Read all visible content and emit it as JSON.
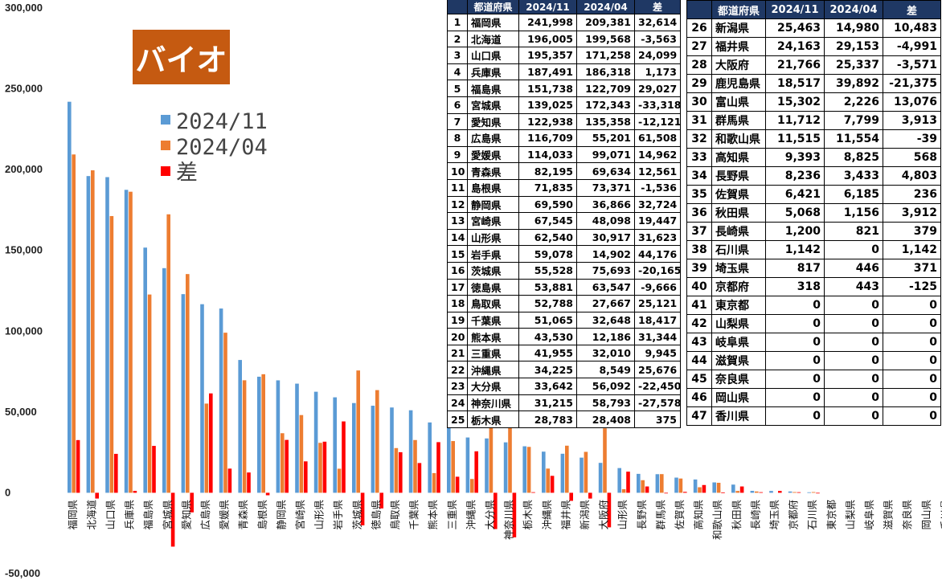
{
  "chart_data": {
    "type": "bar",
    "title": "バイオ",
    "categories": [
      "福岡県",
      "北海道",
      "山口県",
      "兵庫県",
      "福島県",
      "宮城県",
      "愛知県",
      "広島県",
      "愛媛県",
      "青森県",
      "島根県",
      "静岡県",
      "宮崎県",
      "山形県",
      "岩手県",
      "茨城県",
      "徳島県",
      "鳥取県",
      "千葉県",
      "熊本県",
      "三重県",
      "沖縄県",
      "大分県",
      "神奈川県",
      "栃木県",
      "沖縄県",
      "福井県",
      "新潟県",
      "大阪府",
      "山形県",
      "長野県",
      "群馬県",
      "佐賀県",
      "高知県",
      "和歌山県",
      "秋田県",
      "長崎県",
      "埼玉県",
      "京都府",
      "石川県",
      "東京都",
      "山梨県",
      "岐阜県",
      "滋賀県",
      "奈良県",
      "岡山県",
      "香川県"
    ],
    "series": [
      {
        "name": "2024/11",
        "color": "#5b9bd5",
        "values": [
          241998,
          196005,
          195357,
          187491,
          151738,
          139025,
          122938,
          116709,
          114033,
          82195,
          71835,
          69590,
          67545,
          62540,
          59078,
          55528,
          53881,
          52788,
          51065,
          43530,
          41955,
          34225,
          33642,
          31215,
          28783,
          25463,
          24163,
          21766,
          18517,
          15302,
          11712,
          11515,
          9393,
          8236,
          6421,
          5068,
          1200,
          1142,
          817,
          318,
          0,
          0,
          0,
          0,
          0,
          0,
          0
        ]
      },
      {
        "name": "2024/04",
        "color": "#ed7d31",
        "values": [
          209381,
          199568,
          171258,
          186318,
          122709,
          172343,
          135358,
          55201,
          99071,
          69634,
          73371,
          36866,
          48098,
          30917,
          14902,
          75693,
          63547,
          27667,
          32648,
          12186,
          32010,
          8549,
          56092,
          58793,
          28408,
          14980,
          29153,
          25337,
          39892,
          2226,
          7799,
          11554,
          8825,
          3433,
          6185,
          1156,
          821,
          0,
          446,
          443,
          0,
          0,
          0,
          0,
          0,
          0,
          0
        ]
      },
      {
        "name": "差",
        "color": "#ff0000",
        "values": [
          32614,
          -3563,
          24099,
          1173,
          29027,
          -33318,
          -12121,
          61508,
          14962,
          12561,
          -1536,
          32724,
          19447,
          31623,
          44176,
          -20165,
          -9666,
          25121,
          18417,
          31344,
          9945,
          25676,
          -22450,
          -27578,
          375,
          10483,
          -4991,
          -3571,
          -21375,
          13076,
          3913,
          -39,
          568,
          4803,
          236,
          3912,
          379,
          1142,
          371,
          -125,
          0,
          0,
          0,
          0,
          0,
          0,
          0
        ]
      }
    ],
    "ylim": [
      -50000,
      300000
    ],
    "yticks": [
      "-50,000",
      "0",
      "50,000",
      "100,000",
      "150,000",
      "200,000",
      "250,000",
      "300,000"
    ],
    "xlabel": "",
    "ylabel": "",
    "legend_position": "top-left"
  },
  "table_left": {
    "headers": [
      "",
      "都道府県",
      "2024/11",
      "2024/04",
      "差"
    ],
    "rows": [
      [
        "1",
        "福岡県",
        "241,998",
        "209,381",
        "32,614"
      ],
      [
        "2",
        "北海道",
        "196,005",
        "199,568",
        "-3,563"
      ],
      [
        "3",
        "山口県",
        "195,357",
        "171,258",
        "24,099"
      ],
      [
        "4",
        "兵庫県",
        "187,491",
        "186,318",
        "1,173"
      ],
      [
        "5",
        "福島県",
        "151,738",
        "122,709",
        "29,027"
      ],
      [
        "6",
        "宮城県",
        "139,025",
        "172,343",
        "-33,318"
      ],
      [
        "7",
        "愛知県",
        "122,938",
        "135,358",
        "-12,121"
      ],
      [
        "8",
        "広島県",
        "116,709",
        "55,201",
        "61,508"
      ],
      [
        "9",
        "愛媛県",
        "114,033",
        "99,071",
        "14,962"
      ],
      [
        "10",
        "青森県",
        "82,195",
        "69,634",
        "12,561"
      ],
      [
        "11",
        "島根県",
        "71,835",
        "73,371",
        "-1,536"
      ],
      [
        "12",
        "静岡県",
        "69,590",
        "36,866",
        "32,724"
      ],
      [
        "13",
        "宮崎県",
        "67,545",
        "48,098",
        "19,447"
      ],
      [
        "14",
        "山形県",
        "62,540",
        "30,917",
        "31,623"
      ],
      [
        "15",
        "岩手県",
        "59,078",
        "14,902",
        "44,176"
      ],
      [
        "16",
        "茨城県",
        "55,528",
        "75,693",
        "-20,165"
      ],
      [
        "17",
        "徳島県",
        "53,881",
        "63,547",
        "-9,666"
      ],
      [
        "18",
        "鳥取県",
        "52,788",
        "27,667",
        "25,121"
      ],
      [
        "19",
        "千葉県",
        "51,065",
        "32,648",
        "18,417"
      ],
      [
        "20",
        "熊本県",
        "43,530",
        "12,186",
        "31,344"
      ],
      [
        "21",
        "三重県",
        "41,955",
        "32,010",
        "9,945"
      ],
      [
        "22",
        "沖縄県",
        "34,225",
        "8,549",
        "25,676"
      ],
      [
        "23",
        "大分県",
        "33,642",
        "56,092",
        "-22,450"
      ],
      [
        "24",
        "神奈川県",
        "31,215",
        "58,793",
        "-27,578"
      ],
      [
        "25",
        "栃木県",
        "28,783",
        "28,408",
        "375"
      ]
    ]
  },
  "table_right": {
    "headers": [
      "",
      "都道府県",
      "2024/11",
      "2024/04",
      "差"
    ],
    "rows": [
      [
        "26",
        "新潟県",
        "25,463",
        "14,980",
        "10,483"
      ],
      [
        "27",
        "福井県",
        "24,163",
        "29,153",
        "-4,991"
      ],
      [
        "28",
        "大阪府",
        "21,766",
        "25,337",
        "-3,571"
      ],
      [
        "29",
        "鹿児島県",
        "18,517",
        "39,892",
        "-21,375"
      ],
      [
        "30",
        "富山県",
        "15,302",
        "2,226",
        "13,076"
      ],
      [
        "31",
        "群馬県",
        "11,712",
        "7,799",
        "3,913"
      ],
      [
        "32",
        "和歌山県",
        "11,515",
        "11,554",
        "-39"
      ],
      [
        "33",
        "高知県",
        "9,393",
        "8,825",
        "568"
      ],
      [
        "34",
        "長野県",
        "8,236",
        "3,433",
        "4,803"
      ],
      [
        "35",
        "佐賀県",
        "6,421",
        "6,185",
        "236"
      ],
      [
        "36",
        "秋田県",
        "5,068",
        "1,156",
        "3,912"
      ],
      [
        "37",
        "長崎県",
        "1,200",
        "821",
        "379"
      ],
      [
        "38",
        "石川県",
        "1,142",
        "0",
        "1,142"
      ],
      [
        "39",
        "埼玉県",
        "817",
        "446",
        "371"
      ],
      [
        "40",
        "京都府",
        "318",
        "443",
        "-125"
      ],
      [
        "41",
        "東京都",
        "0",
        "0",
        "0"
      ],
      [
        "42",
        "山梨県",
        "0",
        "0",
        "0"
      ],
      [
        "43",
        "岐阜県",
        "0",
        "0",
        "0"
      ],
      [
        "44",
        "滋賀県",
        "0",
        "0",
        "0"
      ],
      [
        "45",
        "奈良県",
        "0",
        "0",
        "0"
      ],
      [
        "46",
        "岡山県",
        "0",
        "0",
        "0"
      ],
      [
        "47",
        "香川県",
        "0",
        "0",
        "0"
      ]
    ]
  }
}
